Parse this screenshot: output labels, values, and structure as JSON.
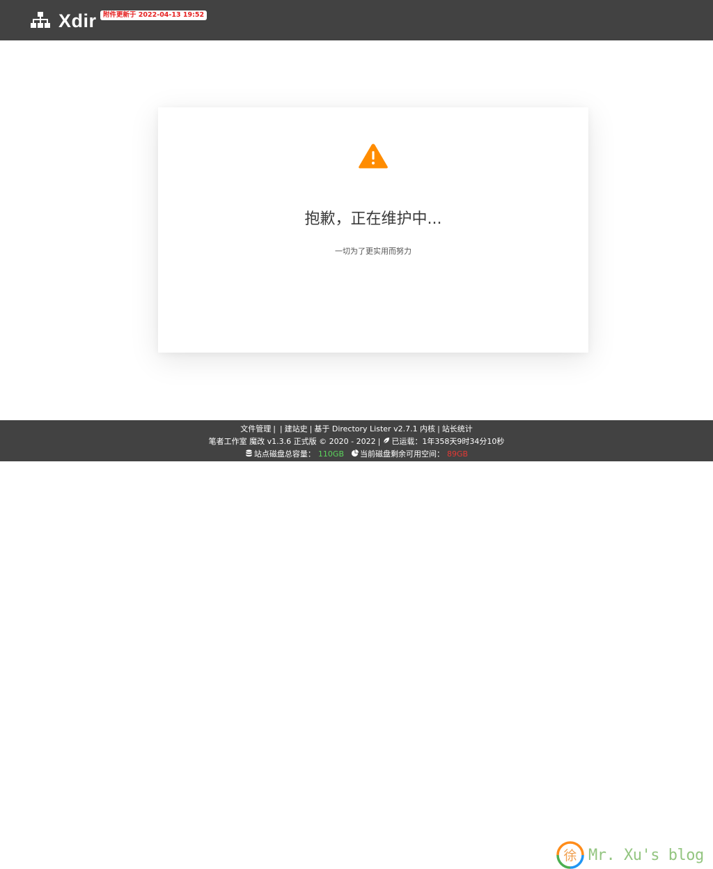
{
  "header": {
    "brand": "Xdir",
    "update_badge": "附件更新于 2022-04-13 19:52"
  },
  "card": {
    "title": "抱歉，正在维护中...",
    "subtitle": "一切为了更实用而努力"
  },
  "footer": {
    "links": [
      {
        "label": "文件管理"
      },
      {
        "label": "建站史"
      }
    ],
    "based_on": "基于 Directory Lister v2.7.1 内核",
    "stats_link": "站长统计",
    "studio": "笔者工作室 魔改 v1.3.6 正式版 © 2020 - 2022",
    "uptime_label": "已运载：",
    "uptime_value": "1年358天9时34分10秒",
    "disk_total_label": "站点磁盘总容量：",
    "disk_total_value": "110GB",
    "disk_free_label": "当前磁盘剩余可用空间：",
    "disk_free_value": "89GB"
  },
  "watermark": {
    "char": "徐",
    "text": "Mr. Xu's blog"
  },
  "colors": {
    "header_bg": "#424242",
    "badge_text": "#e52222",
    "warning": "#ff8c00",
    "disk_total": "#5cd65c",
    "disk_free": "#e53935"
  },
  "icons": [
    "sitemap-icon",
    "warning-triangle-icon",
    "feather-icon",
    "database-icon",
    "pie-chart-icon",
    "blog-logo-icon"
  ]
}
